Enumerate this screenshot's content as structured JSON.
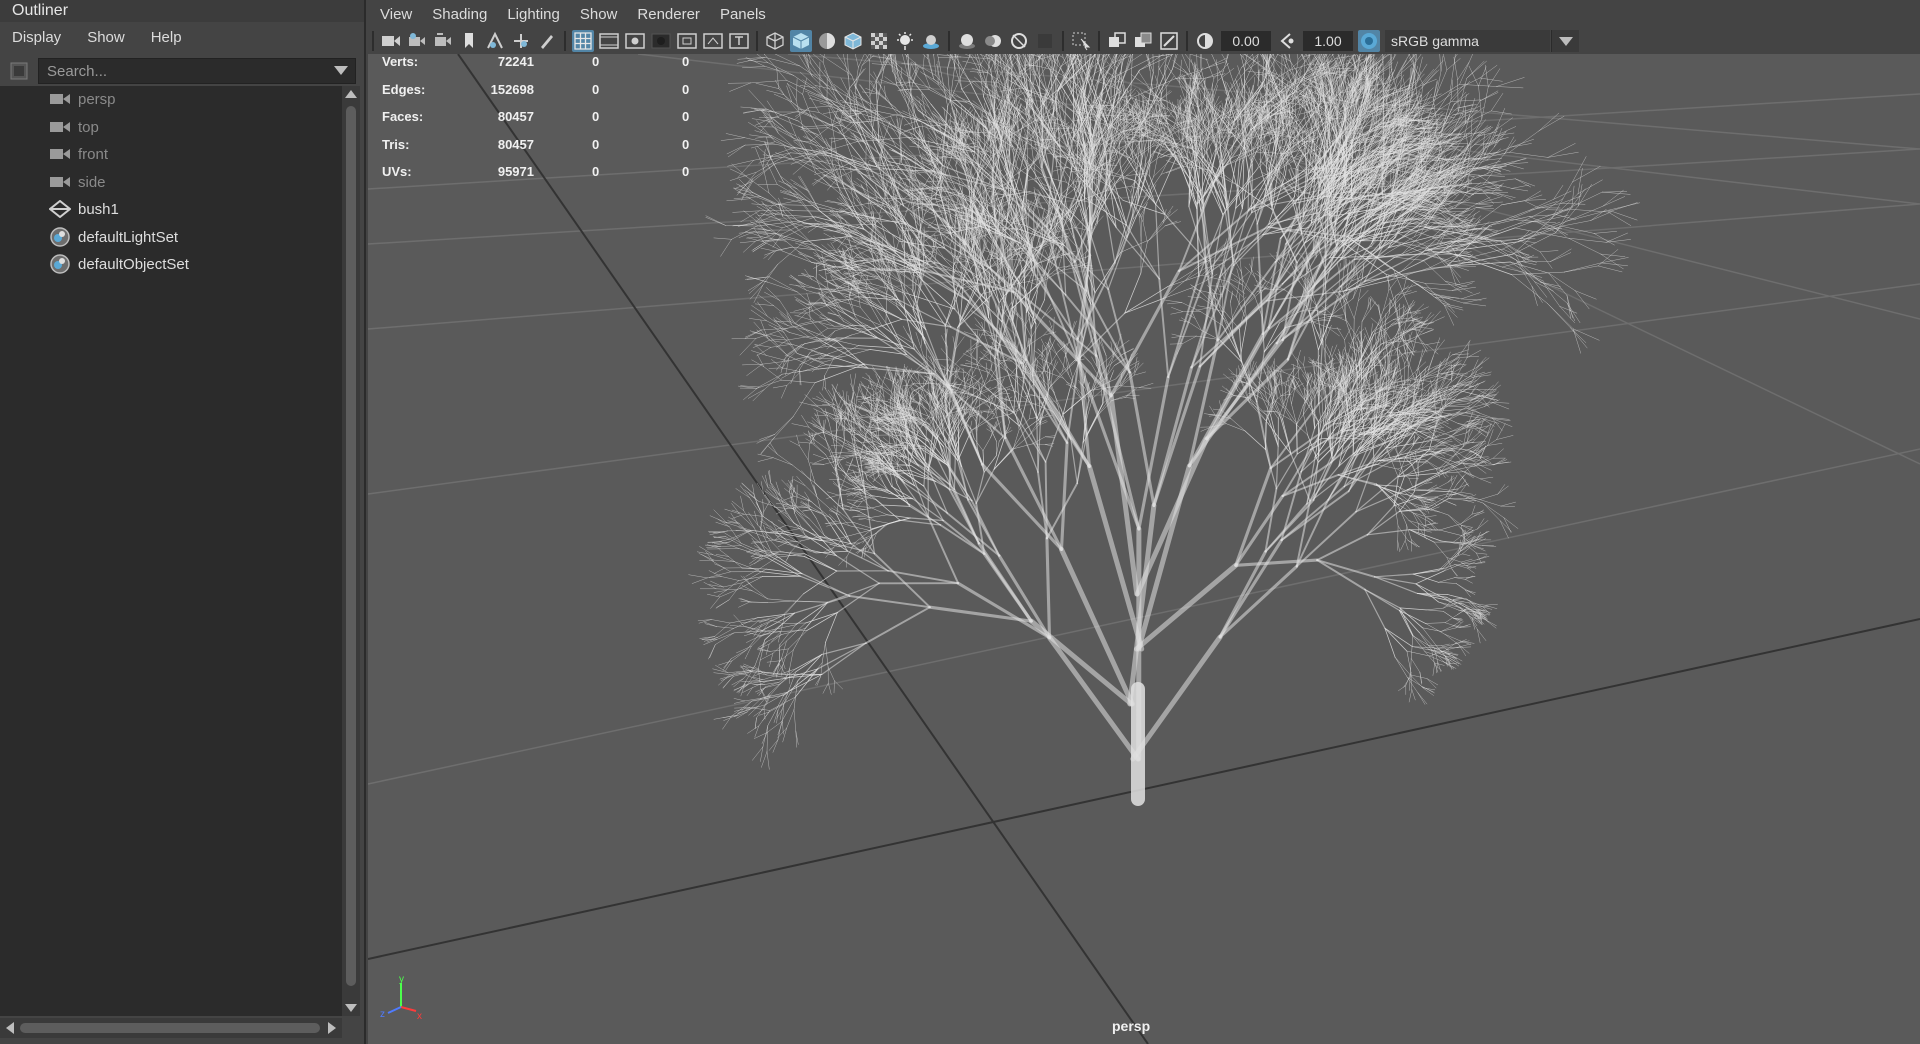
{
  "outliner": {
    "title": "Outliner",
    "menu": [
      "Display",
      "Show",
      "Help"
    ],
    "search": {
      "placeholder": "Search..."
    },
    "items": [
      {
        "label": "persp",
        "type": "camera",
        "icon": "camera-icon"
      },
      {
        "label": "top",
        "type": "camera",
        "icon": "camera-icon"
      },
      {
        "label": "front",
        "type": "camera",
        "icon": "camera-icon"
      },
      {
        "label": "side",
        "type": "camera",
        "icon": "camera-icon"
      },
      {
        "label": "bush1",
        "type": "transform",
        "icon": "transform-icon"
      },
      {
        "label": "defaultLightSet",
        "type": "set",
        "icon": "set-icon"
      },
      {
        "label": "defaultObjectSet",
        "type": "set",
        "icon": "set-icon"
      }
    ]
  },
  "viewport": {
    "menu": [
      "View",
      "Shading",
      "Lighting",
      "Show",
      "Renderer",
      "Panels"
    ],
    "exposure": "0.00",
    "gamma": "1.00",
    "color_space": "sRGB gamma",
    "camera": "persp",
    "hud": [
      {
        "label": "Verts:",
        "total": "72241",
        "selected": "0",
        "component": "0"
      },
      {
        "label": "Edges:",
        "total": "152698",
        "selected": "0",
        "component": "0"
      },
      {
        "label": "Faces:",
        "total": "80457",
        "selected": "0",
        "component": "0"
      },
      {
        "label": "Tris:",
        "total": "80457",
        "selected": "0",
        "component": "0"
      },
      {
        "label": "UVs:",
        "total": "95971",
        "selected": "0",
        "component": "0"
      }
    ],
    "axis_colors": {
      "x": "#ff3b3b",
      "y": "#4cff4c",
      "z": "#4f7bff"
    }
  },
  "colors": {
    "panel": "#444444",
    "list_bg": "#2b2b2b",
    "viewport_bg": "#5a5a5a",
    "accent": "#5285a6"
  }
}
